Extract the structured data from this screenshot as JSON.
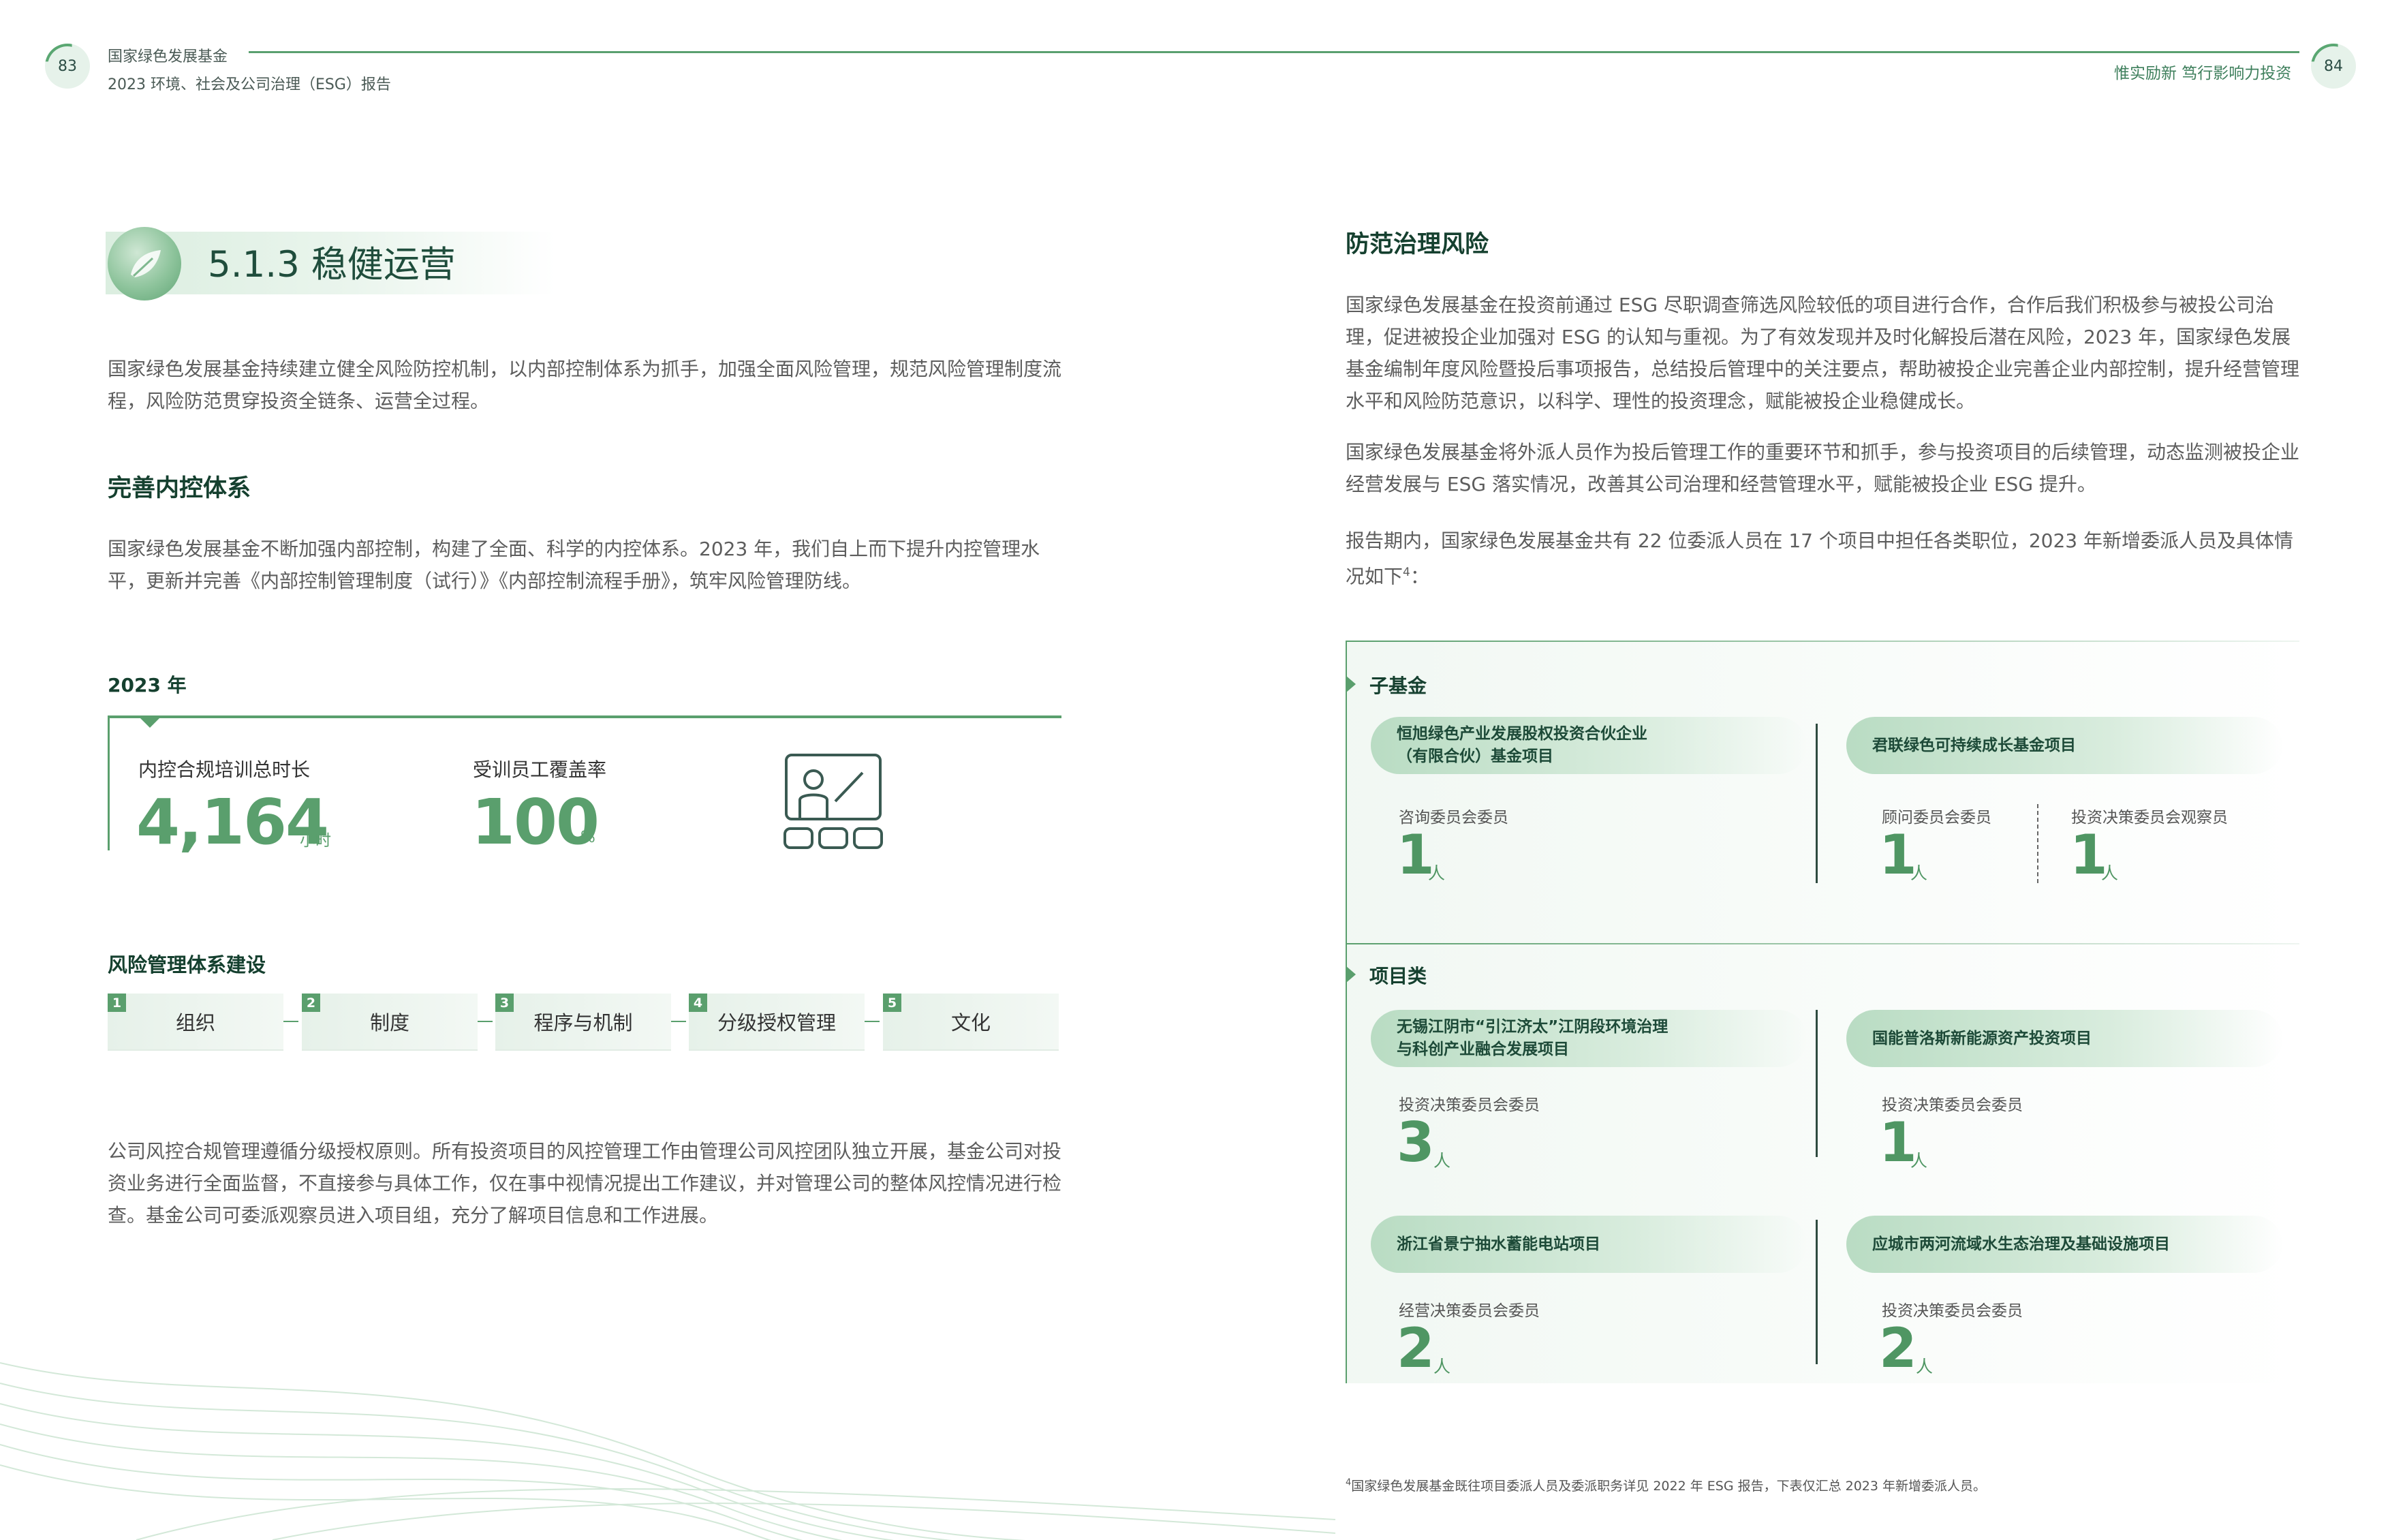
{
  "header": {
    "page_left": "83",
    "page_right": "84",
    "org": "国家绿色发展基金",
    "report": "2023  环境、社会及公司治理（ESG）报告",
    "slogan": "惟实励新  笃行影响力投资"
  },
  "left": {
    "section_title": "5.1.3 稳健运营",
    "intro": "国家绿色发展基金持续建立健全风险防控机制，以内部控制体系为抓手，加强全面风险管理，规范风险管理制度流程，风险防范贯穿投资全链条、运营全过程。",
    "internal_control": {
      "heading": "完善内控体系",
      "text": "国家绿色发展基金不断加强内部控制，构建了全面、科学的内控体系。2023 年，我们自上而下提升内控管理水平，更新并完善《内部控制管理制度（试行）》《内部控制流程手册》，筑牢风险管理防线。"
    },
    "stats": {
      "year": "2023 年",
      "training_label": "内控合规培训总时长",
      "training_value": "4,164",
      "training_unit": "小时",
      "coverage_label": "受训员工覆盖率",
      "coverage_value": "100",
      "coverage_unit": "%",
      "icon": "training-presentation-icon"
    },
    "risk_system": {
      "heading": "风险管理体系建设",
      "steps": [
        {
          "num": "1",
          "label": "组织"
        },
        {
          "num": "2",
          "label": "制度"
        },
        {
          "num": "3",
          "label": "程序与机制"
        },
        {
          "num": "4",
          "label": "分级授权管理"
        },
        {
          "num": "5",
          "label": "文化"
        }
      ]
    },
    "bottom_text": "公司风控合规管理遵循分级授权原则。所有投资项目的风控管理工作由管理公司风控团队独立开展，基金公司对投资业务进行全面监督，不直接参与具体工作，仅在事中视情况提出工作建议，并对管理公司的整体风控情况进行检查。基金公司可委派观察员进入项目组，充分了解项目信息和工作进展。"
  },
  "right": {
    "heading": "防范治理风险",
    "para1": "国家绿色发展基金在投资前通过 ESG 尽职调查筛选风险较低的项目进行合作，合作后我们积极参与被投公司治理，促进被投企业加强对 ESG 的认知与重视。为了有效发现并及时化解投后潜在风险，2023 年，国家绿色发展基金编制年度风险暨投后事项报告，总结投后管理中的关注要点，帮助被投企业完善企业内部控制，提升经营管理水平和风险防范意识，以科学、理性的投资理念，赋能被投企业稳健成长。",
    "para2": "国家绿色发展基金将外派人员作为投后管理工作的重要环节和抓手，参与投资项目的后续管理，动态监测被投企业经营发展与 ESG 落实情况，改善其公司治理和经营管理水平，赋能被投企业 ESG 提升。",
    "para3": "报告期内，国家绿色发展基金共有 22 位委派人员在 17 个项目中担任各类职位，2023 年新增委派人员及具体情况如下",
    "para3_sup": "4",
    "para3_end": "：",
    "categories": {
      "sub_fund": "子基金",
      "project": "项目类"
    },
    "projects": [
      {
        "name": "恒旭绿色产业发展股权投资合伙企业\n（有限合伙）基金项目",
        "roles": [
          {
            "role": "咨询委员会委员",
            "count": "1",
            "unit": "人"
          }
        ]
      },
      {
        "name": "君联绿色可持续成长基金项目",
        "roles": [
          {
            "role": "顾问委员会委员",
            "count": "1",
            "unit": "人"
          },
          {
            "role": "投资决策委员会观察员",
            "count": "1",
            "unit": "人"
          }
        ]
      },
      {
        "name": "无锡江阴市“引江济太”江阴段环境治理\n与科创产业融合发展项目",
        "roles": [
          {
            "role": "投资决策委员会委员",
            "count": "3",
            "unit": "人"
          }
        ]
      },
      {
        "name": "国能普洛斯新能源资产投资项目",
        "roles": [
          {
            "role": "投资决策委员会委员",
            "count": "1",
            "unit": "人"
          }
        ]
      },
      {
        "name": "浙江省景宁抽水蓄能电站项目",
        "roles": [
          {
            "role": "经营决策委员会委员",
            "count": "2",
            "unit": "人"
          }
        ]
      },
      {
        "name": "应城市两河流域水生态治理及基础设施项目",
        "roles": [
          {
            "role": "投资决策委员会委员",
            "count": "2",
            "unit": "人"
          }
        ]
      }
    ],
    "footnote_num": "4",
    "footnote": "国家绿色发展基金既往项目委派人员及委派职务详见 2022 年 ESG 报告，下表仅汇总 2023 年新增委派人员。"
  },
  "colors": {
    "accent": "#5a9f6d",
    "dark_green": "#15402f"
  }
}
